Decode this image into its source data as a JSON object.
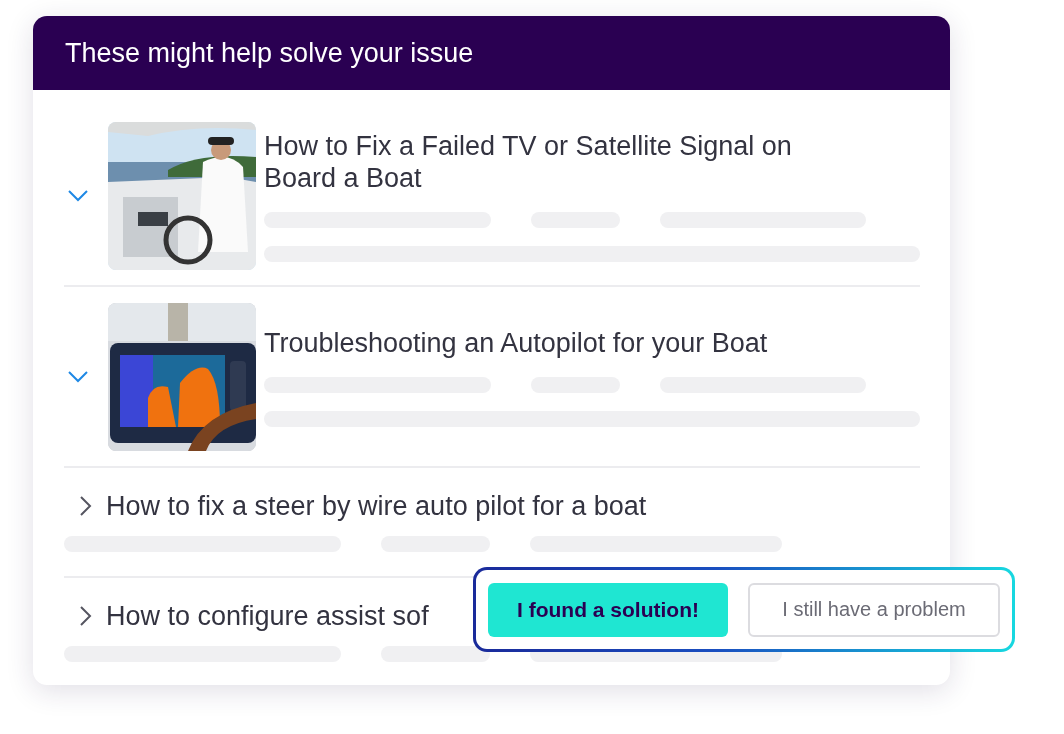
{
  "panel": {
    "title": "These might help solve your issue"
  },
  "articles": [
    {
      "title": "How to Fix a Failed TV or Satellite Signal on Board a Boat",
      "expanded": true
    },
    {
      "title": "Troubleshooting an Autopilot for your Boat",
      "expanded": true
    },
    {
      "title": "How to fix a steer by wire auto pilot for a boat",
      "expanded": false
    },
    {
      "title": "How to configure assist sof",
      "expanded": false
    }
  ],
  "feedback": {
    "buttons": [
      {
        "label": "I found a solution!",
        "kind": "primary"
      },
      {
        "label": "I still have a problem",
        "kind": "secondary"
      }
    ]
  }
}
